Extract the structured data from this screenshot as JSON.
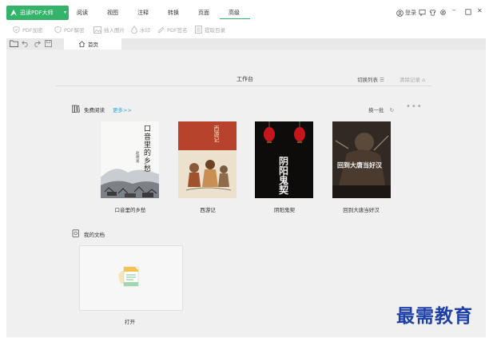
{
  "app": {
    "name": "迅读PDF大师"
  },
  "menu": [
    "阅读",
    "视图",
    "注释",
    "转换",
    "页面",
    "高级"
  ],
  "window": {
    "login": "登录"
  },
  "toolbar": [
    "PDF加密",
    "PDF解密",
    "插入图片",
    "水印",
    "PDF签名",
    "提取目录"
  ],
  "tabs": {
    "home": "首页"
  },
  "workspace": {
    "title": "工作台",
    "switch_list": "切换列表",
    "clear_records": "清除记录",
    "free_reading": {
      "title": "免费阅读",
      "more": "更多>>",
      "swap": "换一批",
      "books": [
        {
          "title": "口音里的乡愁",
          "cover_text": "口音里的乡愁",
          "author": "赵德发"
        },
        {
          "title": "西游记",
          "cover_text": "西游记"
        },
        {
          "title": "阴阳鬼契",
          "cover_text": "阴阳鬼契"
        },
        {
          "title": "回到大唐当好汉",
          "cover_text": "回到大唐当好汉"
        }
      ]
    },
    "my_docs": {
      "title": "我的文档",
      "open": "打开"
    }
  },
  "watermark": "最需教育",
  "colors": {
    "accent": "#33b46a",
    "link": "#33a5d6",
    "content_bg": "#f0f0f0",
    "watermark": "#1e3fa8"
  }
}
